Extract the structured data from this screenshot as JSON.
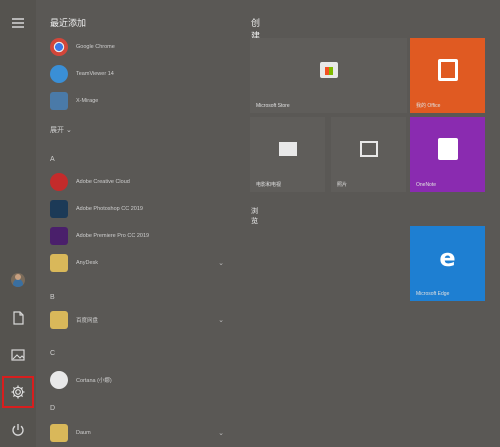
{
  "sidebar": {
    "menu_icon": "hamburger-icon",
    "items": [
      {
        "name": "user-avatar",
        "icon": "avatar"
      },
      {
        "name": "documents-button",
        "icon": "document-icon"
      },
      {
        "name": "pictures-button",
        "icon": "picture-icon"
      },
      {
        "name": "settings-button",
        "icon": "gear-icon",
        "highlighted": true
      },
      {
        "name": "power-button",
        "icon": "power-icon"
      }
    ],
    "highlight_color": "#d81e1e"
  },
  "app_list": {
    "recent_header": "最近添加",
    "recent": [
      {
        "label": "Google Chrome",
        "color": "#c9463d"
      },
      {
        "label": "TeamViewer 14",
        "color": "#3a8fd6"
      },
      {
        "label": "X-Mirage",
        "color": "#4a7aa8"
      }
    ],
    "expand_label": "展开 ⌄",
    "sections": [
      {
        "letter": "A",
        "apps": [
          {
            "label": "Adobe Creative Cloud",
            "color": "#c42b2b",
            "folder": false
          },
          {
            "label": "Adobe Photoshop CC 2019",
            "color": "#1c3a57",
            "folder": false
          },
          {
            "label": "Adobe Premiere Pro CC 2019",
            "color": "#4a1f6b",
            "folder": false
          },
          {
            "label": "AnyDesk",
            "color": "#d9b85a",
            "folder": true
          }
        ]
      },
      {
        "letter": "B",
        "apps": [
          {
            "label": "百度网盘",
            "color": "#d9b85a",
            "folder": true
          }
        ]
      },
      {
        "letter": "C",
        "apps": [
          {
            "label": "Cortana (小娜)",
            "color": "#e8e8e8",
            "folder": false
          }
        ]
      },
      {
        "letter": "D",
        "apps": [
          {
            "label": "Daum",
            "color": "#d9b85a",
            "folder": true
          }
        ]
      }
    ]
  },
  "tiles": {
    "group1_header": "创建",
    "group2_header": "浏览",
    "items": [
      {
        "name": "tile-microsoft-store",
        "label": "Microsoft Store",
        "color": "#5f5d5a"
      },
      {
        "name": "tile-office",
        "label": "我的 Office",
        "color": "#e05a22"
      },
      {
        "name": "tile-movies",
        "label": "电影和电视",
        "color": "#5f5d5a"
      },
      {
        "name": "tile-photos",
        "label": "照片",
        "color": "#5f5d5a"
      },
      {
        "name": "tile-onenote",
        "label": "OneNote",
        "color": "#8a2bb0"
      },
      {
        "name": "tile-edge",
        "label": "Microsoft Edge",
        "color": "#1e7fd2"
      }
    ]
  }
}
